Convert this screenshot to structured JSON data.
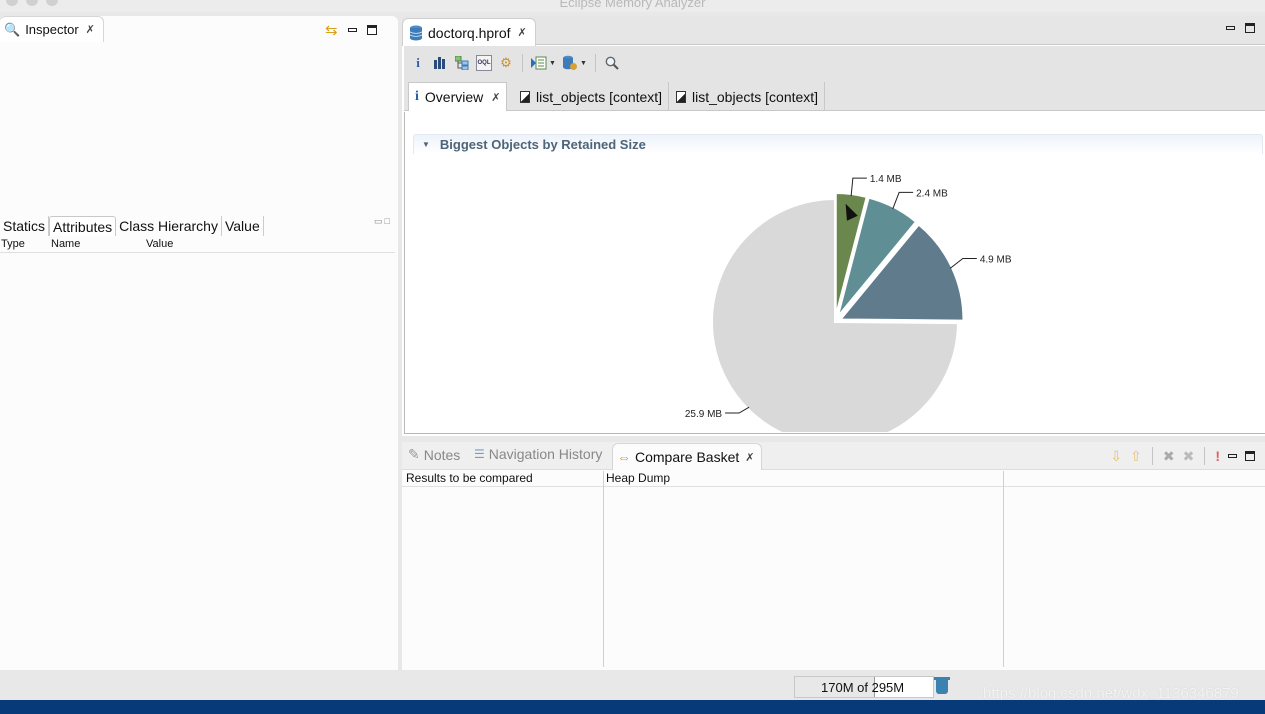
{
  "window": {
    "title": "Eclipse Memory Analyzer"
  },
  "inspector": {
    "tab_label": "Inspector",
    "sub_tabs": [
      "Statics",
      "Attributes",
      "Class Hierarchy",
      "Value"
    ],
    "active_sub_tab": "Attributes",
    "columns": [
      "Type",
      "Name",
      "Value"
    ]
  },
  "editor": {
    "tab_label": "doctorq.hprof",
    "toolbar": [
      {
        "icon": "info-icon"
      },
      {
        "icon": "histogram-icon"
      },
      {
        "icon": "dominator-tree-icon"
      },
      {
        "icon": "oql-icon"
      },
      {
        "icon": "heap-dump-overview-icon"
      },
      {
        "icon": "run-report-icon",
        "dropdown": true
      },
      {
        "icon": "query-browser-icon",
        "dropdown": true
      },
      {
        "icon": "find-object-icon"
      }
    ],
    "page_tabs": [
      {
        "label": "Overview",
        "icon": "info-icon",
        "closable": true,
        "active": true
      },
      {
        "label": "list_objects [context]",
        "icon": "document-icon"
      },
      {
        "label": "list_objects [context]",
        "icon": "document-icon"
      }
    ],
    "section_title": "Biggest Objects by Retained Size"
  },
  "chart_data": {
    "type": "pie",
    "title": "Biggest Objects by Retained Size",
    "unit": "MB",
    "slices": [
      {
        "label": "1.4 MB",
        "value": 1.4,
        "color": "#6a874e"
      },
      {
        "label": "2.4 MB",
        "value": 2.4,
        "color": "#5f8f94"
      },
      {
        "label": "4.9 MB",
        "value": 4.9,
        "color": "#5f7b8c"
      },
      {
        "label": "25.9 MB",
        "value": 25.9,
        "color": "#d9d9d9"
      }
    ],
    "exploded": [
      true,
      true,
      true,
      false
    ]
  },
  "bottom": {
    "tabs": [
      {
        "label": "Notes",
        "icon": "notes-icon"
      },
      {
        "label": "Navigation History",
        "icon": "navigation-history-icon"
      },
      {
        "label": "Compare Basket",
        "icon": "compare-basket-icon",
        "active": true
      }
    ],
    "columns": [
      "Results to be compared",
      "Heap Dump"
    ]
  },
  "status": {
    "heap_text": "170M of 295M",
    "heap_used_mb": 170,
    "heap_total_mb": 295,
    "watermark": "https://blog.csdn.net/wdx_1136346879"
  }
}
